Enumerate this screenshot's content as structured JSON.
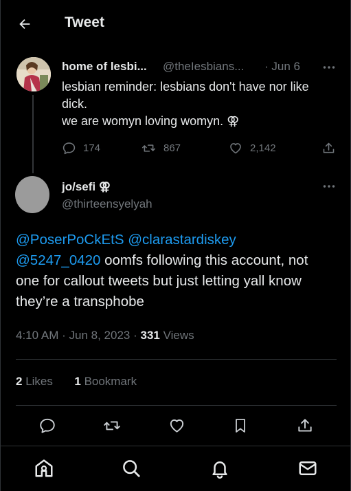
{
  "header": {
    "title": "Tweet"
  },
  "parent_tweet": {
    "author_name": "home of lesbi...",
    "handle": "@theIesbians...",
    "date": "· Jun 6",
    "lines": [
      "lesbian reminder: lesbians don't have nor like",
      "dick.",
      "we are womyn loving womyn. ⚢"
    ],
    "replies": "174",
    "retweets": "867",
    "likes": "2,142"
  },
  "main_tweet": {
    "author_name": "jo/sefi ⚢",
    "handle": "@thirteensyelyah",
    "mentions": [
      "@PoserPoCkEtS",
      "@clarastardiskey",
      "@5247_0420"
    ],
    "text_line2": " oomfs following this account, not",
    "text_line3": "one for callout tweets but just letting yall know",
    "text_line4": "they’re a transphobe",
    "time": "4:10 AM",
    "date": "Jun 8, 2023",
    "views_count": "331",
    "views_label": "Views",
    "likes_count": "2",
    "likes_label": "Likes",
    "bookmarks_count": "1",
    "bookmarks_label": "Bookmark"
  },
  "icons": {
    "back": "arrow-left-icon",
    "reply": "reply-icon",
    "retweet": "retweet-icon",
    "like": "heart-icon",
    "bookmark": "bookmark-icon",
    "share": "share-icon",
    "more": "more-icon",
    "home": "home-icon",
    "search": "search-icon",
    "notifications": "bell-icon",
    "messages": "mail-icon"
  },
  "colors": {
    "background": "#000000",
    "text": "#e7e9ea",
    "muted": "#71767b",
    "link": "#1d9bf0",
    "border": "#2f3336"
  }
}
